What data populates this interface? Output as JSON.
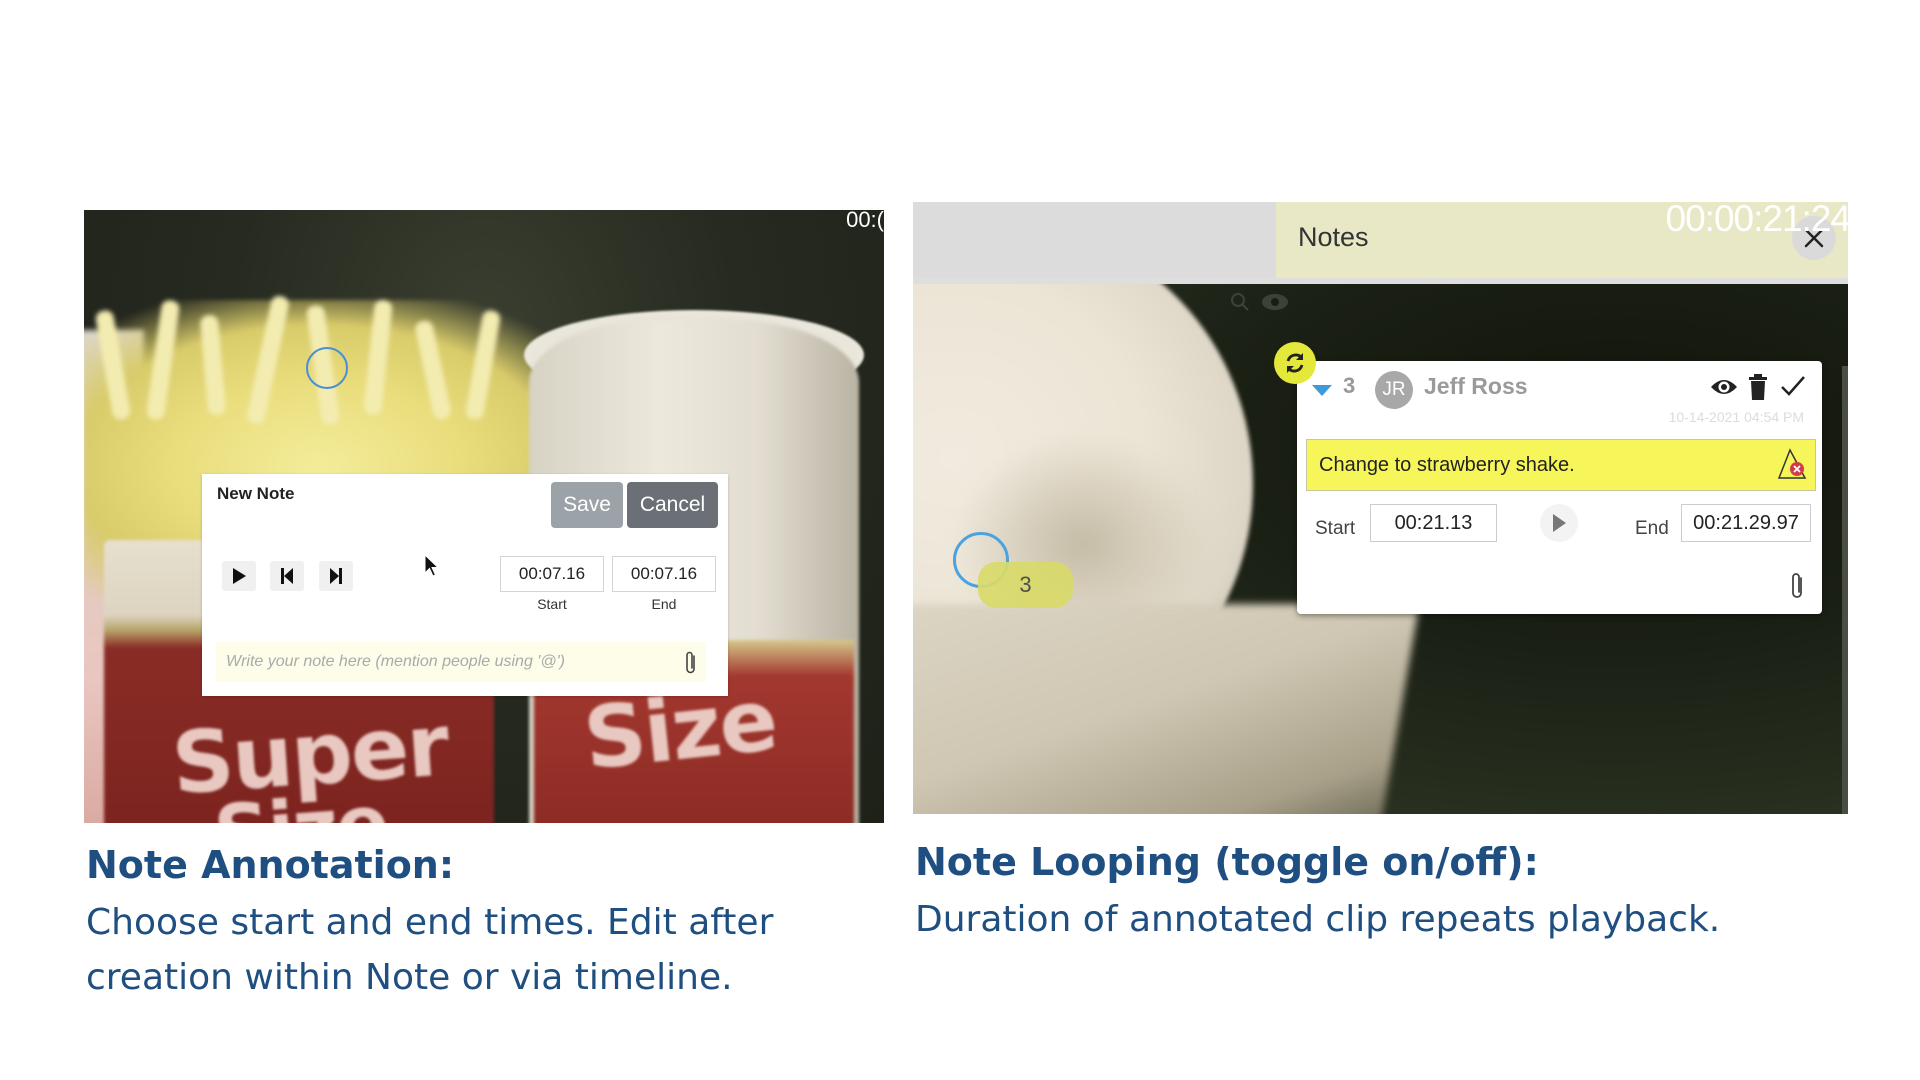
{
  "left_demo": {
    "video_timecode": "00:(",
    "new_note": {
      "title": "New Note",
      "save_label": "Save",
      "cancel_label": "Cancel",
      "controls": [
        "play-icon",
        "skip-back-icon",
        "skip-forward-icon"
      ],
      "start_value": "00:07.16",
      "end_value": "00:07.16",
      "start_label": "Start",
      "end_label": "End",
      "note_placeholder": "Write your note here (mention people using '@')",
      "attach_icon": "paperclip-icon"
    },
    "background_text": [
      "Super",
      "Size",
      "Size"
    ]
  },
  "right_demo": {
    "panel_title": "Notes",
    "close_icon": "close-icon",
    "video_timecode": "00:00:21:24",
    "marker_number": "3",
    "note": {
      "number": "3",
      "avatar_initials": "JR",
      "author": "Jeff Ross",
      "timestamp": "10-14-2021 04:54 PM",
      "text": "Change to strawberry shake.",
      "start_label": "Start",
      "start_value": "00:21.13",
      "end_label": "End",
      "end_value": "00:21.29.97",
      "actions": [
        "eye-icon",
        "trash-icon",
        "check-icon"
      ]
    },
    "loop_toggle": "loop-icon"
  },
  "captions": {
    "left_title": "Note Annotation:",
    "left_body": "Choose start and end times. Edit after creation within Note or via timeline.",
    "right_title": "Note Looping (toggle on/off):",
    "right_body": "Duration of annotated clip repeats playback."
  },
  "colors": {
    "caption_blue": "#1f4e80",
    "note_highlight": "#f6f65a",
    "loop_toggle": "#e4e83a",
    "notes_header": "#e8e8c6",
    "marker_blue": "#4aa3e0"
  }
}
